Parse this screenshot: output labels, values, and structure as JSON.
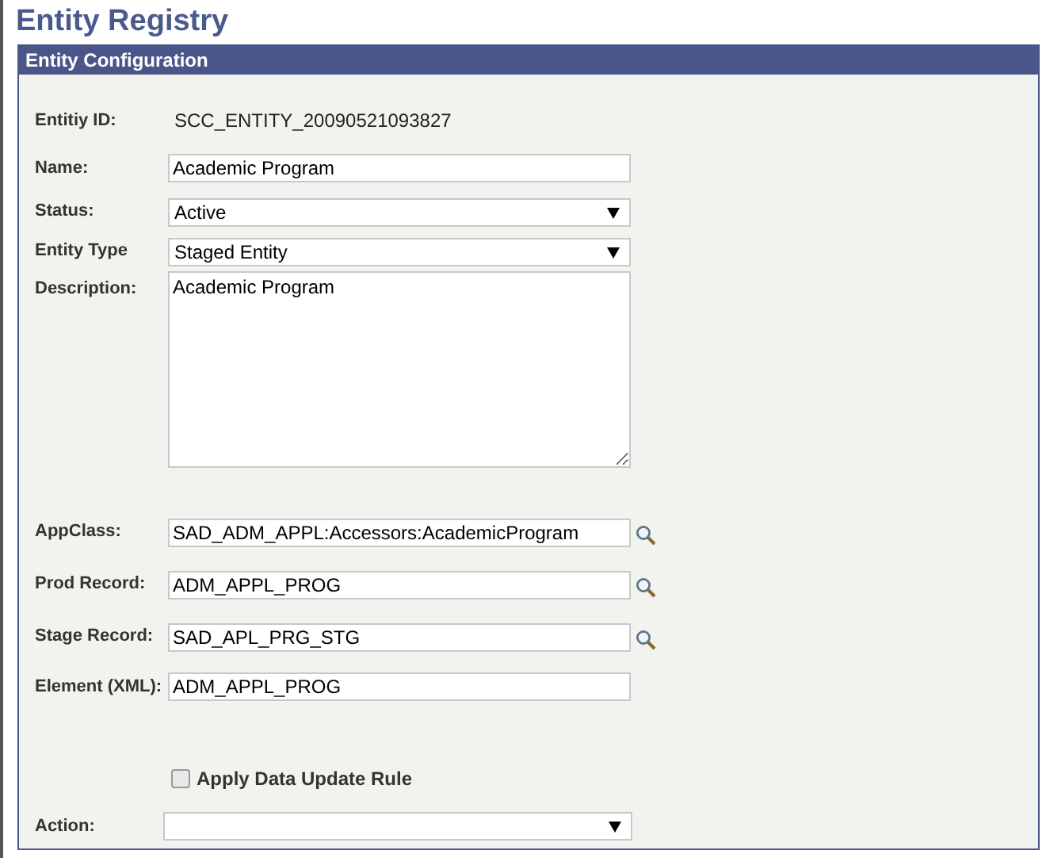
{
  "page_title": "Entity Registry",
  "panel": {
    "title": "Entity Configuration",
    "fields": [
      {
        "kind": "display",
        "label": "Entitiy ID:",
        "value": "SCC_ENTITY_20090521093827"
      },
      {
        "kind": "input",
        "label": "Name:",
        "value": "Academic Program"
      },
      {
        "kind": "select",
        "label": "Status:",
        "value": "Active"
      },
      {
        "kind": "select",
        "label": "Entity Type",
        "value": "Staged Entity"
      },
      {
        "kind": "textarea",
        "label": "Description:",
        "value": "Academic Program"
      },
      {
        "kind": "lookup",
        "label": "AppClass:",
        "value": "SAD_ADM_APPL:Accessors:AcademicProgram"
      },
      {
        "kind": "lookup",
        "label": "Prod Record:",
        "value": "ADM_APPL_PROG"
      },
      {
        "kind": "lookup",
        "label": "Stage Record:",
        "value": "SAD_APL_PRG_STG"
      },
      {
        "kind": "input",
        "label": "Element (XML):",
        "value": "ADM_APPL_PROG"
      }
    ],
    "checkbox": {
      "label": "Apply Data Update Rule",
      "checked": false
    },
    "action": {
      "label": "Action:"
    }
  }
}
